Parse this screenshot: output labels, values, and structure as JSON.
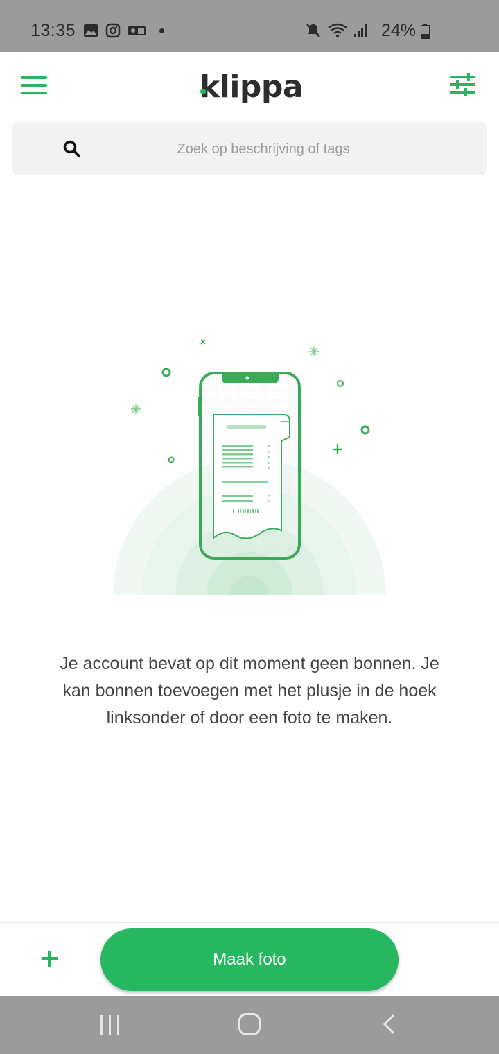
{
  "status_bar": {
    "time": "13:35",
    "battery": "24%"
  },
  "header": {
    "logo_text": "klippa",
    "menu_icon": "hamburger-menu-icon",
    "filter_icon": "sliders-filter-icon"
  },
  "search": {
    "placeholder": "Zoek op beschrijving of tags",
    "icon": "search-icon"
  },
  "empty_state": {
    "illustration": "phone-with-receipt-illustration",
    "message": "Je account bevat op dit moment geen bonnen. Je kan bonnen toevoegen met het plusje in de hoek linksonder of door een foto te maken."
  },
  "bottom_bar": {
    "add_icon": "plus-icon",
    "photo_button_label": "Maak foto"
  },
  "colors": {
    "accent": "#27b760",
    "status_bar_bg": "#9b9b9b",
    "text": "#444444"
  }
}
